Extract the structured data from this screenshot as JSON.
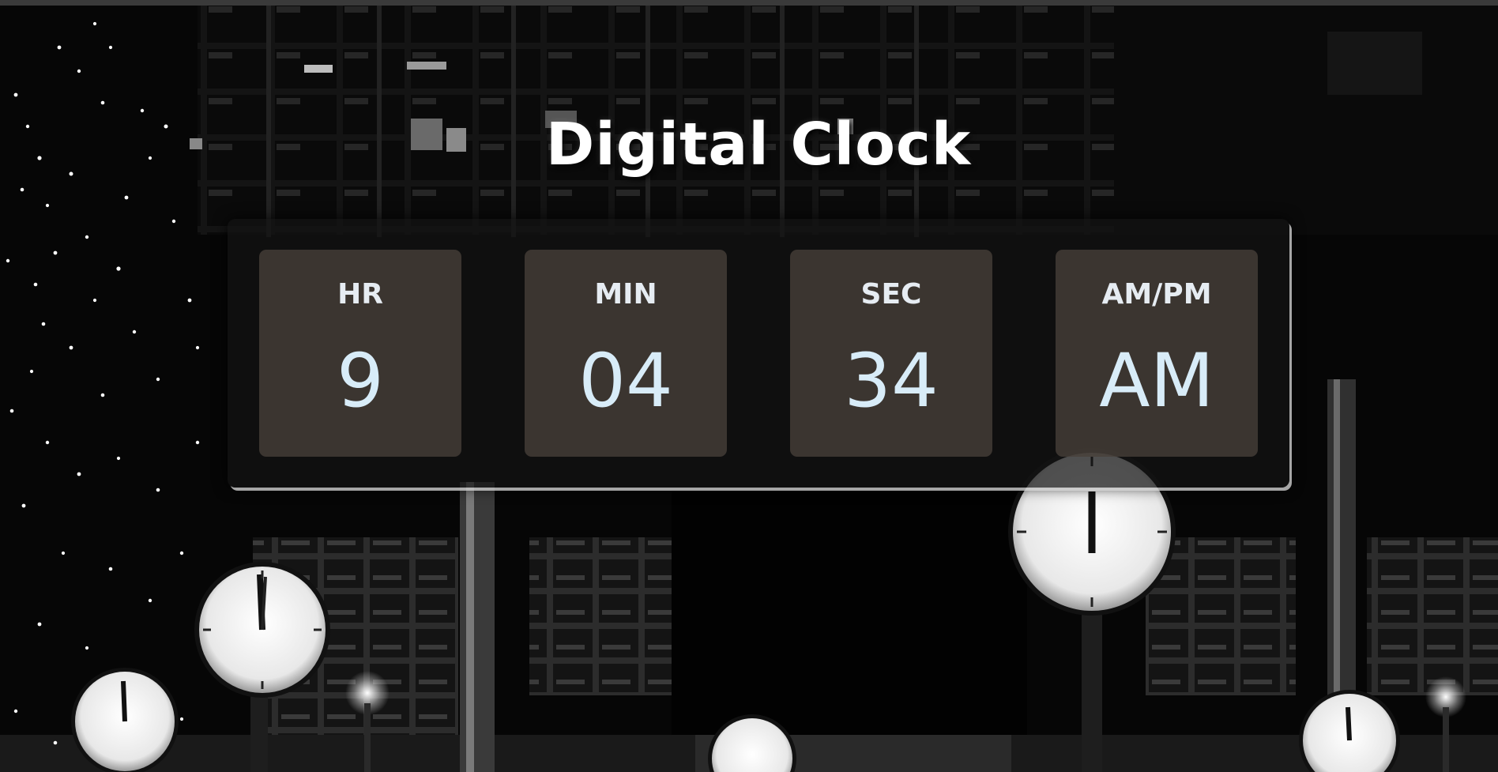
{
  "page": {
    "title": "Digital Clock"
  },
  "clock": {
    "units": [
      {
        "label": "HR",
        "value": "9"
      },
      {
        "label": "MIN",
        "value": "04"
      },
      {
        "label": "SEC",
        "value": "34"
      },
      {
        "label": "AM/PM",
        "value": "AM"
      }
    ]
  },
  "colors": {
    "title": "#ffffff",
    "unit_label": "#e6ecf2",
    "unit_value": "#d8ecf8",
    "panel_bg": "rgba(20,20,20,0.72)",
    "unit_bg": "rgba(72,64,58,0.78)",
    "panel_edge": "#dcdcdc"
  }
}
